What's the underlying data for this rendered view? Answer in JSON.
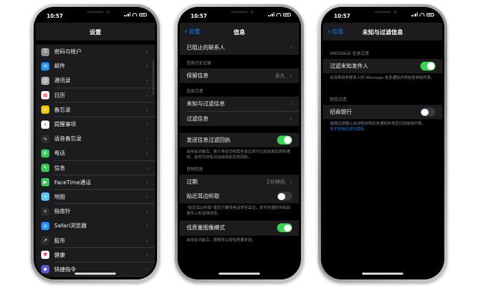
{
  "status_time": "10:57",
  "colors": {
    "accent": "#0a84ff",
    "toggle_on": "#32d74b",
    "background": "#000000",
    "cell": "#1c1c1e"
  },
  "phone1": {
    "title": "设置",
    "items": [
      {
        "label": "密码与帐户",
        "icon": "key-icon",
        "color": "#8e8e93"
      },
      {
        "label": "邮件",
        "icon": "mail-icon",
        "color": "#1e90ff"
      },
      {
        "label": "通讯录",
        "icon": "contacts-icon",
        "color": "#a8a8ad"
      },
      {
        "label": "日历",
        "icon": "calendar-icon",
        "color": "#ffffff"
      },
      {
        "label": "备忘录",
        "icon": "notes-icon",
        "color": "#f5c400"
      },
      {
        "label": "提醒事项",
        "icon": "reminders-icon",
        "color": "#ffffff"
      },
      {
        "label": "语音备忘录",
        "icon": "voice-memos-icon",
        "color": "#2c2c2e"
      },
      {
        "label": "电话",
        "icon": "phone-icon",
        "color": "#34c759"
      },
      {
        "label": "信息",
        "icon": "messages-icon",
        "color": "#34c759"
      },
      {
        "label": "FaceTime通话",
        "icon": "facetime-icon",
        "color": "#34c759"
      },
      {
        "label": "地图",
        "icon": "maps-icon",
        "color": "#5ac8fa"
      },
      {
        "label": "指南针",
        "icon": "compass-icon",
        "color": "#2c2c2e"
      },
      {
        "label": "Safari浏览器",
        "icon": "safari-icon",
        "color": "#1e90ff"
      },
      {
        "label": "股市",
        "icon": "stocks-icon",
        "color": "#2c2c2e"
      },
      {
        "label": "健康",
        "icon": "health-icon",
        "color": "#ffffff"
      },
      {
        "label": "快捷指令",
        "icon": "shortcuts-icon",
        "color": "#5856d6"
      }
    ]
  },
  "phone2": {
    "back_label": "设置",
    "title": "信息",
    "blocked_contacts": "已阻止的联系人",
    "history_header": "信息历史记录",
    "keep_messages": "保留信息",
    "keep_messages_value": "永久",
    "filter_header": "信息过滤",
    "unknown_filter": "未知与过滤信息",
    "filtered_messages": "过滤信息",
    "send_receipts": "发送信息过滤回执",
    "send_receipts_note": "启用此功能后，他人将在您将其信息过滤为垃圾信息后得到通知。这将为所有对话启用此状态回执。",
    "audio_header": "音频信息",
    "expire": "过期",
    "expire_value": "2分钟后",
    "raise_to_listen": "贴近耳边听取",
    "raise_note": "“贴近耳边听取”使您只要将电话举至耳边，即可快速聆听和回复传入的音频信息。",
    "low_quality": "低质量图像模式",
    "low_quality_note": "启用此功能后，图像将以较低质量发送。"
  },
  "phone3": {
    "back_label": "信息",
    "title": "未知与过滤信息",
    "imessage_header": "IMESSAGE 信息过滤",
    "filter_unknown": "过滤未知发件人",
    "filter_unknown_note": "关闭来自非联系人的 iMessage 信息通知并将信息单独列表。",
    "sms_header": "短信过滤",
    "bank_label": "招商银行",
    "bank_note": "选择过滤器以关闭短信和彩信通知并将其归到单独列表。",
    "about_link": "关于短信过滤与隐私"
  }
}
